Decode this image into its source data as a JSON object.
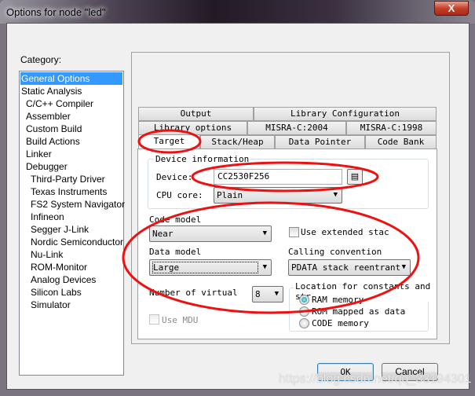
{
  "window": {
    "title": "Options for node \"led\"",
    "close_label": "X"
  },
  "category": {
    "label": "Category:",
    "items": [
      {
        "label": "General Options",
        "level": 0,
        "selected": true
      },
      {
        "label": "Static Analysis",
        "level": 0
      },
      {
        "label": "C/C++ Compiler",
        "level": 1
      },
      {
        "label": "Assembler",
        "level": 1
      },
      {
        "label": "Custom Build",
        "level": 1
      },
      {
        "label": "Build Actions",
        "level": 1
      },
      {
        "label": "Linker",
        "level": 1
      },
      {
        "label": "Debugger",
        "level": 1
      },
      {
        "label": "Third-Party Driver",
        "level": 2
      },
      {
        "label": "Texas Instruments",
        "level": 2
      },
      {
        "label": "FS2 System Navigator",
        "level": 2
      },
      {
        "label": "Infineon",
        "level": 2
      },
      {
        "label": "Segger J-Link",
        "level": 2
      },
      {
        "label": "Nordic Semiconductor",
        "level": 2
      },
      {
        "label": "Nu-Link",
        "level": 2
      },
      {
        "label": "ROM-Monitor",
        "level": 2
      },
      {
        "label": "Analog Devices",
        "level": 2
      },
      {
        "label": "Silicon Labs",
        "level": 2
      },
      {
        "label": "Simulator",
        "level": 2
      }
    ]
  },
  "tabs": {
    "row1": [
      "Output",
      "Library Configuration"
    ],
    "row2": [
      "Library options",
      "MISRA-C:2004",
      "MISRA-C:1998"
    ],
    "row3": [
      "Target",
      "Stack/Heap",
      "Data Pointer",
      "Code Bank"
    ],
    "active": "Target"
  },
  "target": {
    "device_group": "Device information",
    "device_label": "Device:",
    "device_value": "CC2530F256",
    "cpu_label": "CPU core:",
    "cpu_value": "Plain",
    "code_model_label": "Code model",
    "code_model_value": "Near",
    "extended_stack_label": "Use extended stac",
    "extended_stack_checked": false,
    "data_model_label": "Data model",
    "data_model_value": "Large",
    "calling_label": "Calling convention",
    "calling_value": "PDATA stack reentrant",
    "virtual_label": "Number of virtual",
    "virtual_value": "8",
    "mdu_label": "Use MDU",
    "mdu_checked": false,
    "location_group": "Location for constants and str",
    "location_options": [
      "RAM memory",
      "ROM mapped as data",
      "CODE memory"
    ],
    "location_selected": "RAM memory"
  },
  "buttons": {
    "ok": "OK",
    "cancel": "Cancel"
  },
  "watermark": "https://blog.csdn.net/qq_33194301",
  "annotation_color": "#ee1111"
}
